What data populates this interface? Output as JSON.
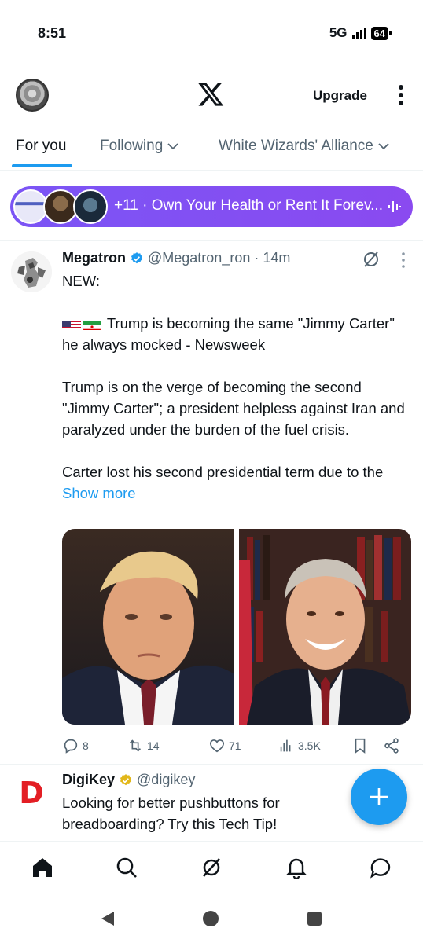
{
  "status_bar": {
    "time": "8:51",
    "network": "5G",
    "battery": "64"
  },
  "header": {
    "upgrade_label": "Upgrade"
  },
  "tabs": [
    {
      "label": "For you"
    },
    {
      "label": "Following"
    },
    {
      "label": "White Wizards' Alliance"
    }
  ],
  "spaces_banner": {
    "text": "+11 · Own Your Health or Rent It Forev..."
  },
  "post": {
    "name": "Megatron",
    "handle": "@Megatron_ron",
    "time": "· 14m",
    "lines": {
      "l1": "NEW:",
      "l2": "Trump is becoming the same \"Jimmy Carter\" he always mocked - Newsweek",
      "l3": "Trump is on the verge of becoming the second \"Jimmy Carter\"; a president helpless against Iran and paralyzed under the burden of the fuel crisis.",
      "l4": "Carter lost his second presidential term due to the"
    },
    "show_more": "Show more",
    "stats": {
      "replies": "8",
      "reposts": "14",
      "likes": "71",
      "views": "3.5K"
    }
  },
  "post2": {
    "name": "DigiKey",
    "handle": "@digikey",
    "body": "Looking for better pushbuttons for breadboarding? Try this Tech Tip!",
    "logo_letter": "D"
  },
  "colors": {
    "accent": "#1d9bf0",
    "pill": "#7b55f5",
    "digikey_red": "#e31e24"
  }
}
